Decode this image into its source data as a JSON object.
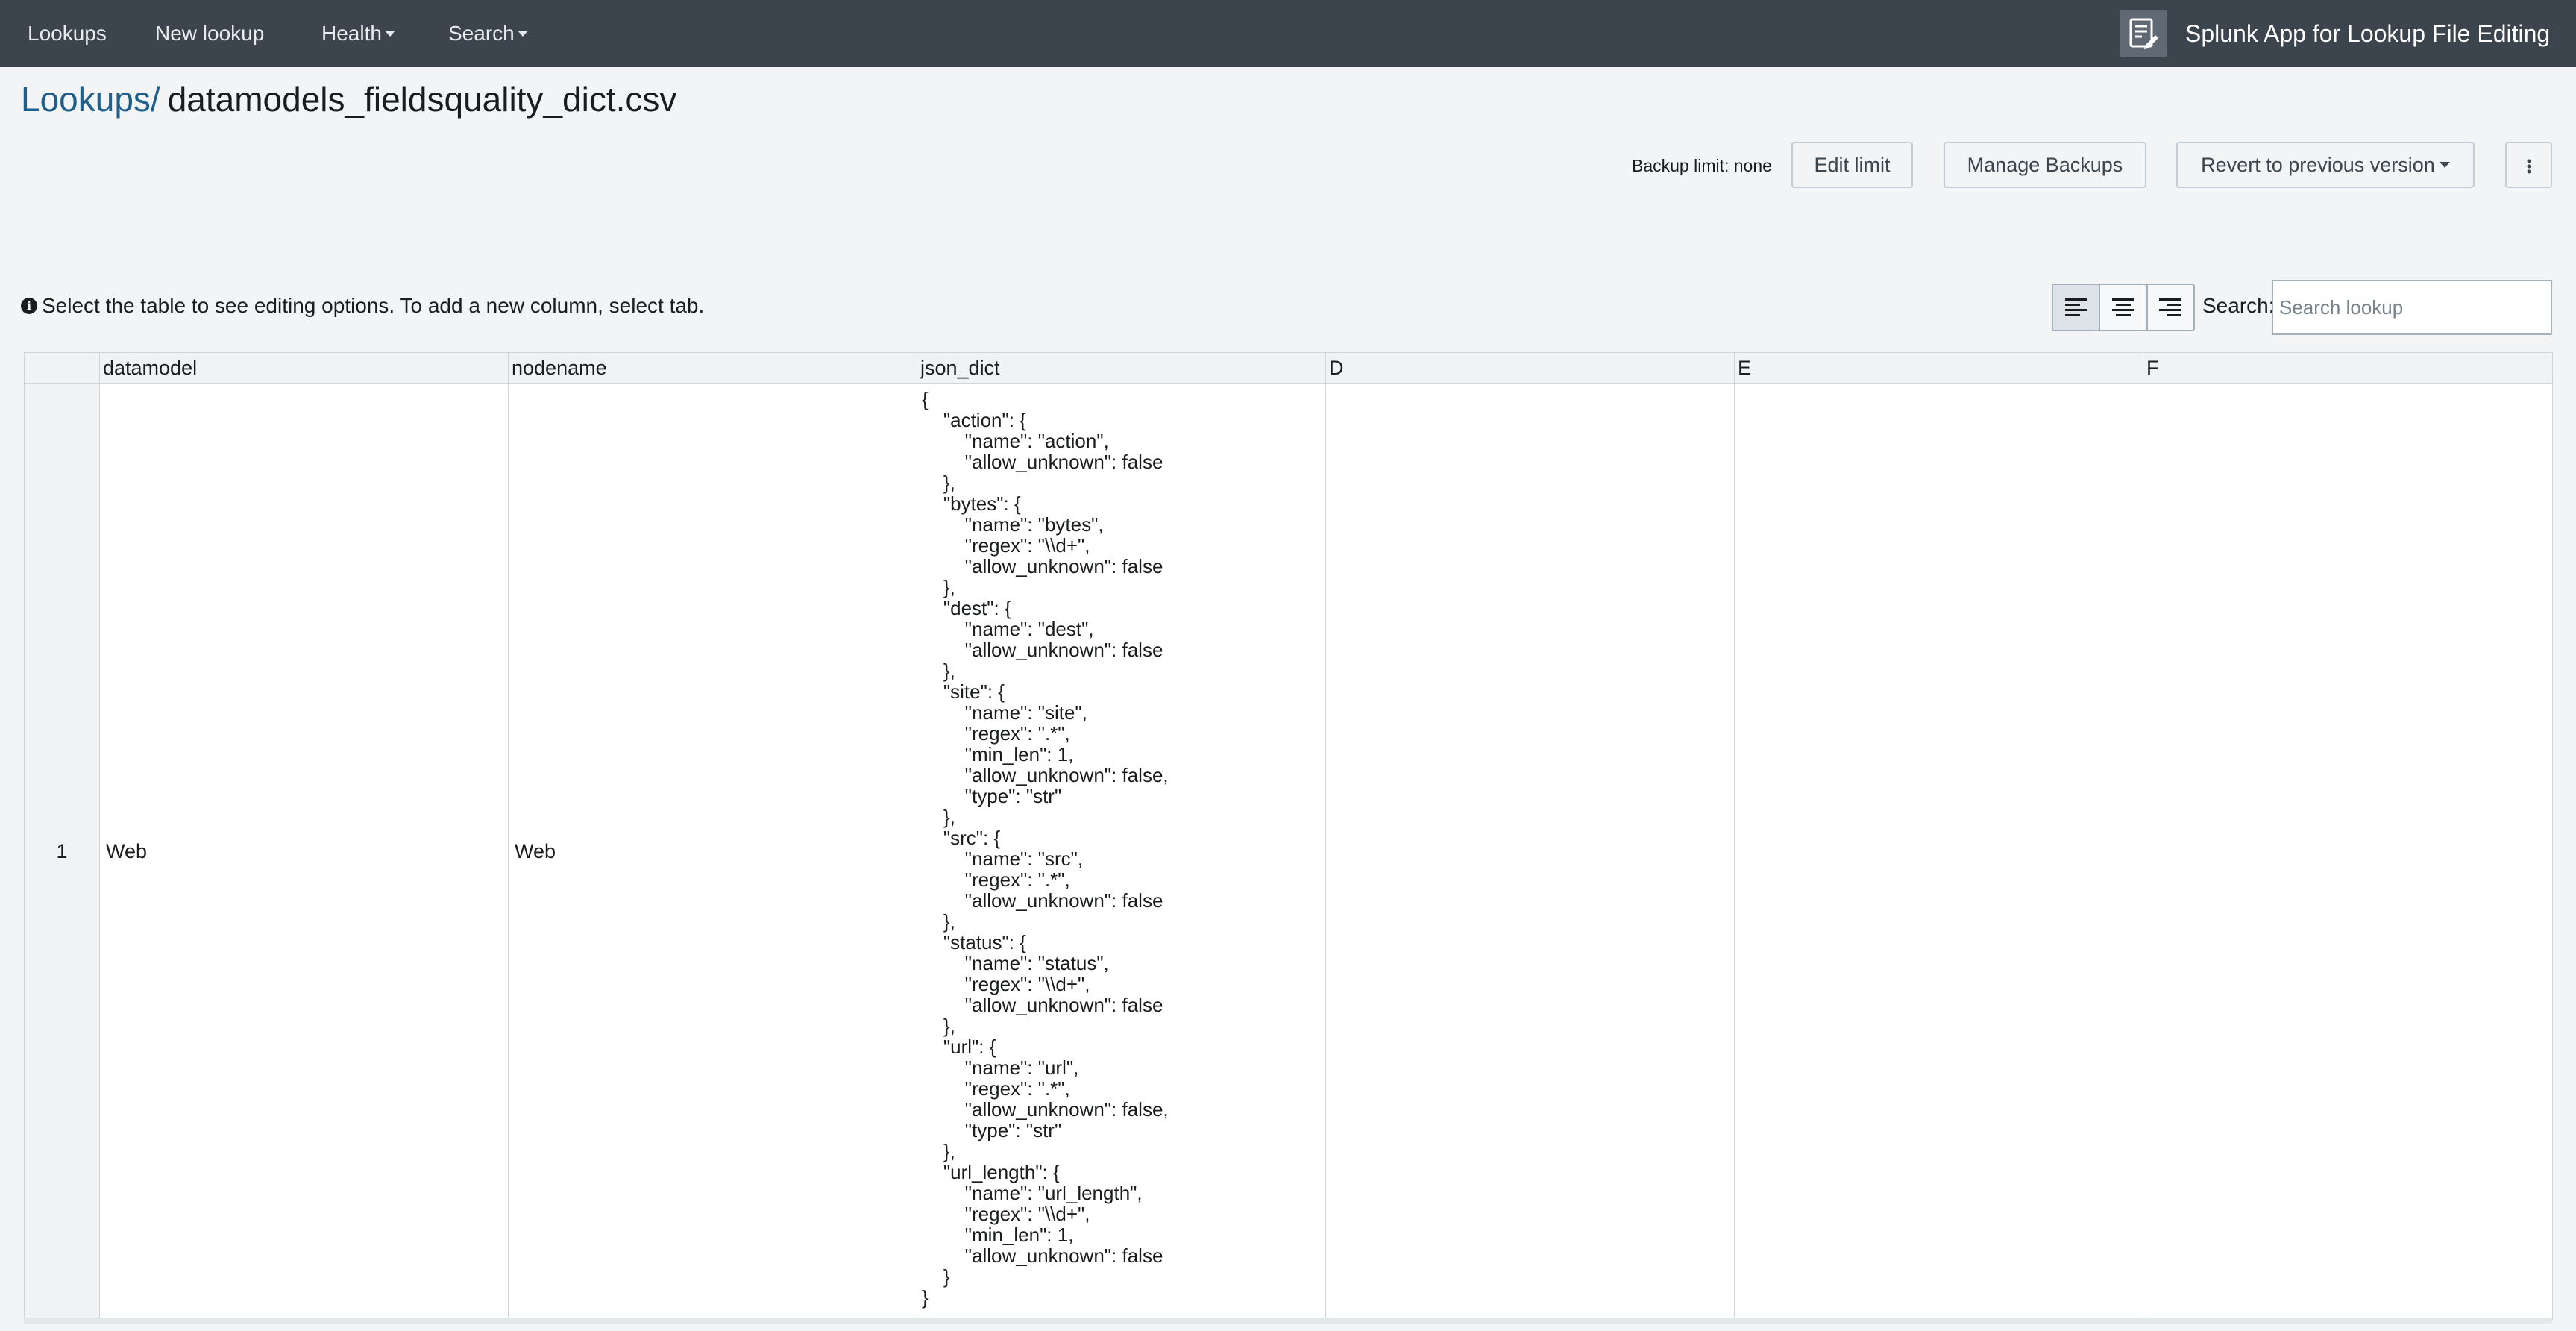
{
  "navbar": {
    "items": [
      {
        "label": "Lookups"
      },
      {
        "label": "New lookup"
      },
      {
        "label": "Health"
      },
      {
        "label": "Search"
      }
    ],
    "app_title": "Splunk App for Lookup File Editing",
    "app_icon": "lookup-editor-icon"
  },
  "breadcrumb": {
    "parent": "Lookups/",
    "current": "datamodels_fieldsquality_dict.csv"
  },
  "toolbar": {
    "backup_limit_label": "Backup limit: none",
    "edit_limit": "Edit limit",
    "manage_backups": "Manage Backups",
    "revert": "Revert to previous version",
    "more_icon": "more-vertical-icon"
  },
  "info": {
    "text": "Select the table to see editing options. To add a new column, select tab.",
    "icon": "info-icon"
  },
  "alignment": {
    "options": [
      "align-left-icon",
      "align-center-icon",
      "align-right-icon"
    ],
    "active": "align-left-icon"
  },
  "search": {
    "label": "Search:",
    "placeholder": "Search lookup",
    "value": ""
  },
  "table": {
    "columns": [
      "datamodel",
      "nodename",
      "json_dict",
      "D",
      "E",
      "F"
    ],
    "rows": [
      {
        "index": "1",
        "datamodel": "Web",
        "nodename": "Web",
        "json_dict": "{\n    \"action\": {\n        \"name\": \"action\",\n        \"allow_unknown\": false\n    },\n    \"bytes\": {\n        \"name\": \"bytes\",\n        \"regex\": \"\\\\d+\",\n        \"allow_unknown\": false\n    },\n    \"dest\": {\n        \"name\": \"dest\",\n        \"allow_unknown\": false\n    },\n    \"site\": {\n        \"name\": \"site\",\n        \"regex\": \".*\",\n        \"min_len\": 1,\n        \"allow_unknown\": false,\n        \"type\": \"str\"\n    },\n    \"src\": {\n        \"name\": \"src\",\n        \"regex\": \".*\",\n        \"allow_unknown\": false\n    },\n    \"status\": {\n        \"name\": \"status\",\n        \"regex\": \"\\\\d+\",\n        \"allow_unknown\": false\n    },\n    \"url\": {\n        \"name\": \"url\",\n        \"regex\": \".*\",\n        \"allow_unknown\": false,\n        \"type\": \"str\"\n    },\n    \"url_length\": {\n        \"name\": \"url_length\",\n        \"regex\": \"\\\\d+\",\n        \"min_len\": 1,\n        \"allow_unknown\": false\n    }\n}",
        "D": "",
        "E": "",
        "F": ""
      }
    ]
  }
}
